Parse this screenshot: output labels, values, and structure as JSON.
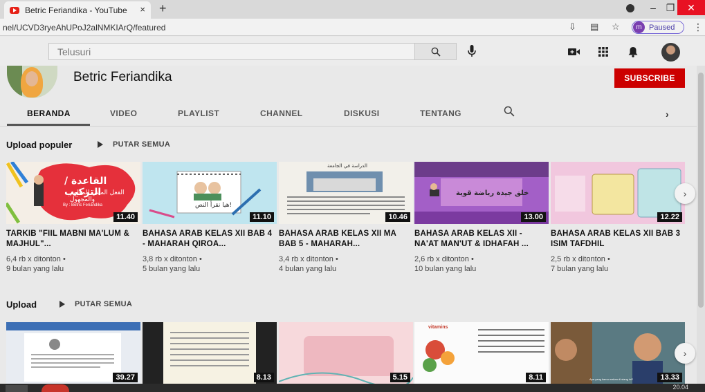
{
  "browser": {
    "tab_title": "Betric Feriandika - YouTube",
    "tab_close": "×",
    "new_tab": "+",
    "url": "nel/UCVD3ryeAhUPoJ2alNMKIArQ/featured",
    "profile_initial": "m",
    "profile_status": "Paused",
    "win_minimize": "–",
    "win_restore": "❐",
    "win_close": "✕",
    "menu": "⋮"
  },
  "youtube": {
    "search_placeholder": "Telusuri",
    "channel_name": "Betric Feriandika",
    "subscribe_label": "SUBSCRIBE",
    "tabs": [
      "BERANDA",
      "VIDEO",
      "PLAYLIST",
      "CHANNEL",
      "DISKUSI",
      "TENTANG"
    ],
    "active_tab": "BERANDA",
    "tab_next": "›"
  },
  "sections": [
    {
      "title": "Upload populer",
      "play_all": "PUTAR SEMUA",
      "videos": [
        {
          "title": "TARKIB \"FIIL MABNI MA'LUM & MAJHUL\"...",
          "views": "6,4 rb x ditonton •",
          "age": "9 bulan yang lalu",
          "duration": "11.40"
        },
        {
          "title": "BAHASA ARAB KELAS XII BAB 4 - MAHARAH QIROA...",
          "views": "3,8 rb x ditonton •",
          "age": "5 bulan yang lalu",
          "duration": "11.10"
        },
        {
          "title": "BAHASA ARAB KELAS XII MA BAB 5 - MAHARAH...",
          "views": "3,4 rb x ditonton •",
          "age": "4 bulan yang lalu",
          "duration": "10.46"
        },
        {
          "title": "BAHASA ARAB KELAS XII - NA'AT MAN'UT & IDHAFAH ...",
          "views": "2,6 rb x ditonton •",
          "age": "10 bulan yang lalu",
          "duration": "13.00"
        },
        {
          "title": "BAHASA ARAB KELAS XII BAB 3 ISIM TAFDHIL",
          "views": "2,5 rb x ditonton •",
          "age": "7 bulan yang lalu",
          "duration": "12.22"
        }
      ]
    },
    {
      "title": "Upload",
      "play_all": "PUTAR SEMUA",
      "videos": [
        {
          "duration": "39.27"
        },
        {
          "duration": "8.13"
        },
        {
          "duration": "5.15"
        },
        {
          "duration": "8.11"
        },
        {
          "duration": "13.33"
        }
      ]
    }
  ],
  "thumb_texts": {
    "v1_main": "القاعدة / التركيب",
    "v1_sub": "الفعل المبني للمعلوم والمجهول",
    "v1_author": "By : Betric Feriandika",
    "v2_main": "هيا نقرأ النص!",
    "v3_main": "الدراسة في الجامعة",
    "v4_main": "خلق جيدة رياضة قوية",
    "v8_main": "vitamins",
    "v10_caption": "Apa yang kamu makan di siang ini?"
  },
  "arrow": "›",
  "clock": "20.04",
  "colors": {
    "subscribe": "#cc0000",
    "youtube_red": "#e62117",
    "paused": "#7a6ad8"
  }
}
